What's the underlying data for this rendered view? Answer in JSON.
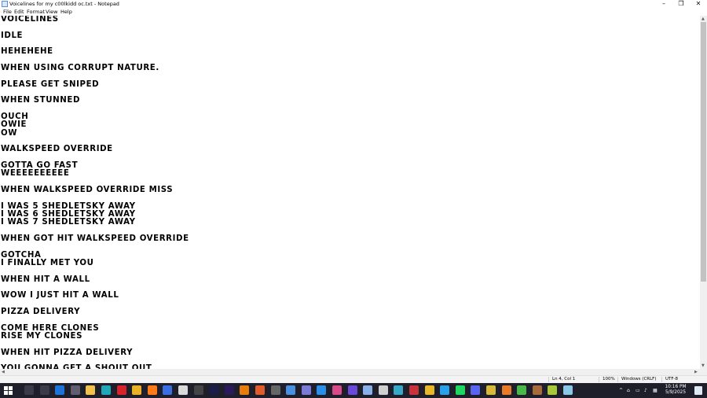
{
  "window": {
    "title": "Voicelines for my c00lkidd oc.txt - Notepad",
    "minimize": "–",
    "maximize": "❐",
    "close": "✕"
  },
  "menu": [
    "File",
    "Edit",
    "Format",
    "View",
    "Help"
  ],
  "lines": [
    "VOICELINES",
    "",
    "IDLE",
    "",
    "HEHEHEHE",
    "",
    "WHEN USING CORRUPT NATURE.",
    "",
    "PLEASE GET SNIPED",
    "",
    "WHEN STUNNED",
    "",
    "OUCH",
    "OWIE",
    "OW",
    "",
    "WALKSPEED OVERRIDE",
    "",
    "GOTTA GO FAST",
    "WEEEEEEEEEE",
    "",
    "WHEN WALKSPEED OVERRIDE MISS",
    "",
    "I WAS 5 SHEDLETSKY AWAY",
    "I WAS 6 SHEDLETSKY AWAY",
    "I WAS 7 SHEDLETSKY AWAY",
    "",
    "WHEN GOT HIT WALKSPEED OVERRIDE",
    "",
    "GOTCHA",
    "I FINALLY MET YOU",
    "",
    "WHEN HIT A WALL",
    "",
    "WOW I JUST HIT A WALL",
    "",
    "PIZZA DELIVERY",
    "",
    "COME HERE CLONES",
    "RISE MY CLONES",
    "",
    "WHEN HIT PIZZA DELIVERY",
    "",
    "YOU GONNA GET A SHOUT OUT"
  ],
  "status": {
    "position": "Ln 4, Col 1",
    "zoom": "100%",
    "line_ending": "Windows (CRLF)",
    "encoding": "UTF-8"
  },
  "taskbar": {
    "time": "10:16 PM",
    "date": "5/9/2025",
    "tray_chevron": "^",
    "icons": [
      {
        "name": "search",
        "color": "#3a3a4a"
      },
      {
        "name": "task-view",
        "color": "#3a3a4a"
      },
      {
        "name": "mail",
        "color": "#1e73d8"
      },
      {
        "name": "store",
        "color": "#5f5f6f"
      },
      {
        "name": "file-explorer",
        "color": "#f2c14b"
      },
      {
        "name": "edge",
        "color": "#1fa8b8"
      },
      {
        "name": "opera",
        "color": "#d8232a"
      },
      {
        "name": "chrome",
        "color": "#e9b226"
      },
      {
        "name": "firefox",
        "color": "#ff7a1a"
      },
      {
        "name": "app-blue",
        "color": "#3b6ee3"
      },
      {
        "name": "roblox",
        "color": "#d9d9d9"
      },
      {
        "name": "app-dark",
        "color": "#444"
      },
      {
        "name": "animate",
        "color": "#1c1c48"
      },
      {
        "name": "premiere",
        "color": "#2a1a5a"
      },
      {
        "name": "blender",
        "color": "#e87d0d"
      },
      {
        "name": "app-flame",
        "color": "#e25b2b"
      },
      {
        "name": "app-grey",
        "color": "#666"
      },
      {
        "name": "app-chrome2",
        "color": "#4a8fe0"
      },
      {
        "name": "app-editor",
        "color": "#7b7bd6"
      },
      {
        "name": "vscode",
        "color": "#2a8fe8"
      },
      {
        "name": "app-pink",
        "color": "#d84a8a"
      },
      {
        "name": "app-purple",
        "color": "#6a4ad8"
      },
      {
        "name": "app-grid",
        "color": "#8ab0e8"
      },
      {
        "name": "media",
        "color": "#cfcfcf"
      },
      {
        "name": "app-teal",
        "color": "#37a8c8"
      },
      {
        "name": "app-red",
        "color": "#c8323a"
      },
      {
        "name": "app-yellow",
        "color": "#e8b828"
      },
      {
        "name": "app-blue2",
        "color": "#2aa0e8"
      },
      {
        "name": "spotify",
        "color": "#1ed760"
      },
      {
        "name": "discord",
        "color": "#5865f2"
      },
      {
        "name": "app-gold",
        "color": "#d8b838"
      },
      {
        "name": "app-orange",
        "color": "#e87a2a"
      },
      {
        "name": "app-green",
        "color": "#4ab848"
      },
      {
        "name": "app-brown",
        "color": "#a86a3a"
      },
      {
        "name": "app-lime",
        "color": "#a8c838"
      },
      {
        "name": "notepad",
        "color": "#8ac8e8"
      }
    ]
  },
  "colors": {
    "text": "#000000",
    "taskbar": "#1f1f2b",
    "scroll_thumb": "#c2c2c2"
  }
}
